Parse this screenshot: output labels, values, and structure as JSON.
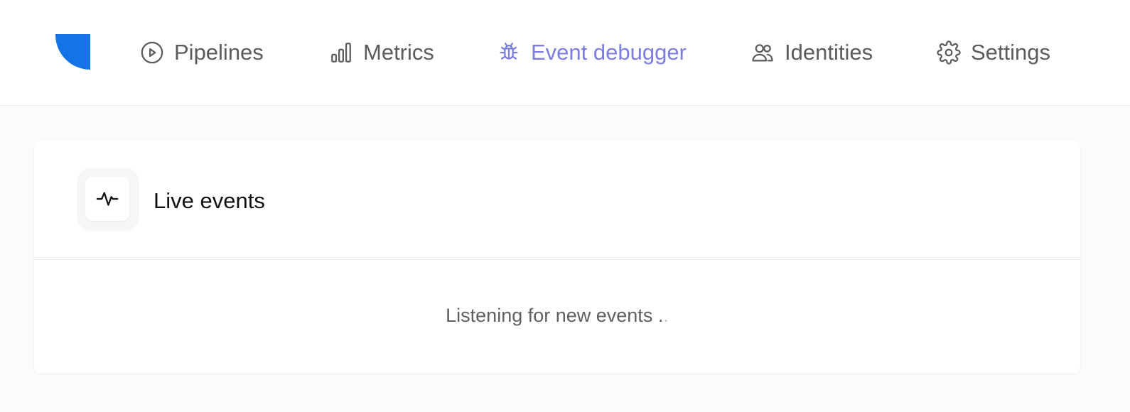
{
  "nav": {
    "items": [
      {
        "label": "Pipelines",
        "icon": "play-circle-icon"
      },
      {
        "label": "Metrics",
        "icon": "bar-chart-icon"
      },
      {
        "label": "Event debugger",
        "icon": "bug-icon"
      },
      {
        "label": "Identities",
        "icon": "users-icon"
      },
      {
        "label": "Settings",
        "icon": "gear-icon"
      }
    ],
    "active_color": "#7b7ee0",
    "color": "#5c5c5f"
  },
  "logo": {
    "color": "#1473e6"
  },
  "card": {
    "title": "Live events",
    "icon": "activity-icon",
    "status_text": "Listening for new events .",
    "status_dot": "."
  }
}
